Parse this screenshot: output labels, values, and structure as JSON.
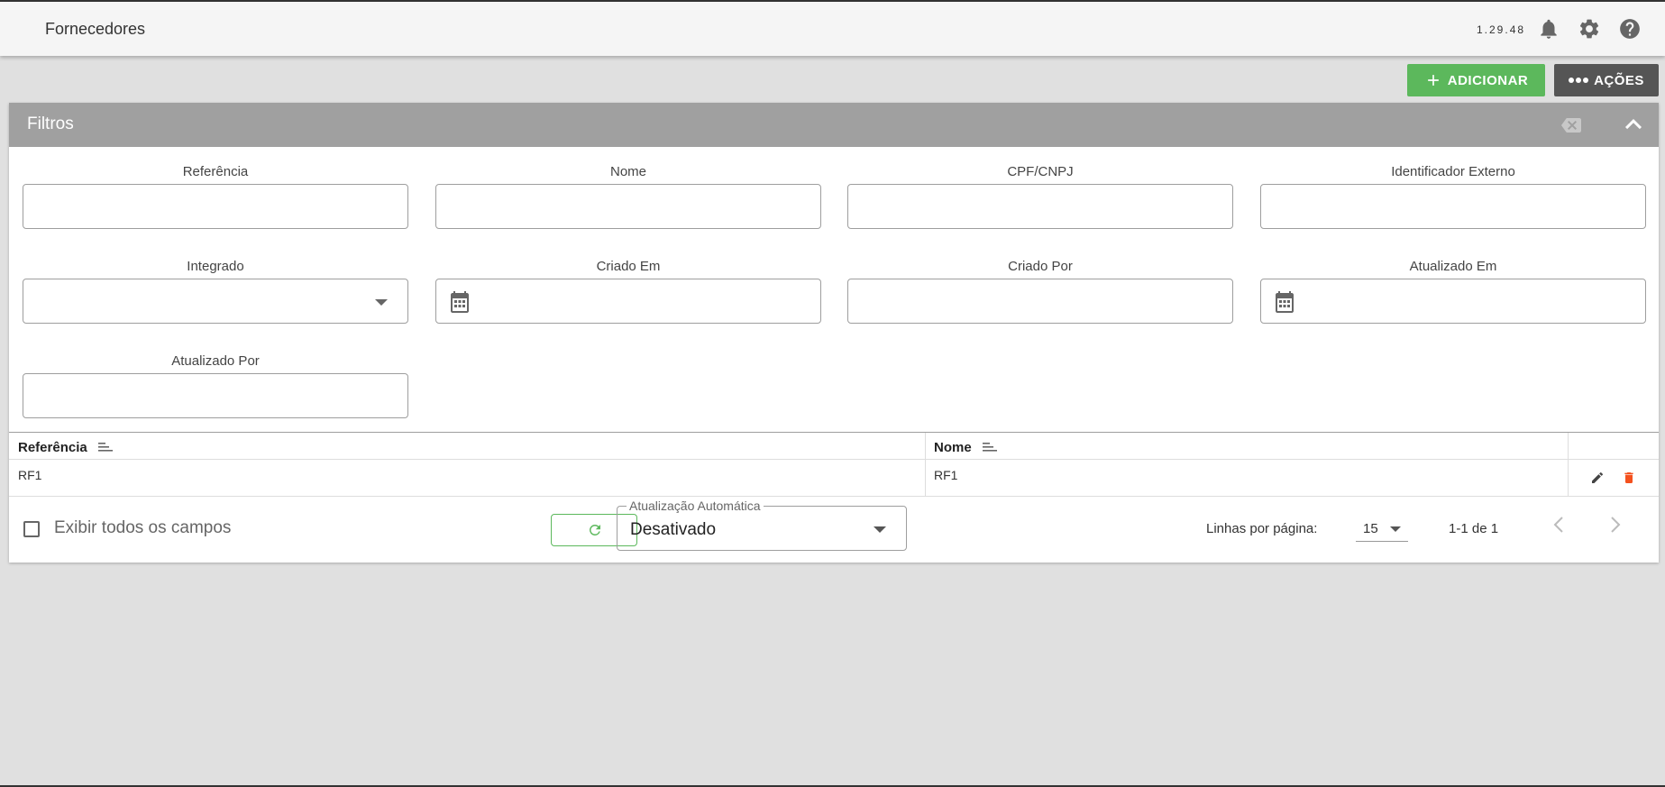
{
  "header": {
    "title": "Fornecedores",
    "version": "1.29.48",
    "icons": [
      "bell-icon",
      "gear-icon",
      "help-icon"
    ]
  },
  "toolbar": {
    "add_label": "ADICIONAR",
    "actions_label": "AÇÕES"
  },
  "filters": {
    "title": "Filtros",
    "fields": {
      "referencia": "Referência",
      "nome": "Nome",
      "cpf_cnpj": "CPF/CNPJ",
      "identificador_externo": "Identificador Externo",
      "integrado": "Integrado",
      "criado_em": "Criado Em",
      "criado_por": "Criado Por",
      "atualizado_em": "Atualizado Em",
      "atualizado_por": "Atualizado Por"
    }
  },
  "grid": {
    "columns": [
      "Referência",
      "Nome"
    ],
    "rows": [
      {
        "referencia": "RF1",
        "nome": "RF1"
      }
    ]
  },
  "footer": {
    "show_all_fields": "Exibir todos os campos",
    "auto_update_label": "Atualização Automática",
    "auto_update_value": "Desativado",
    "rows_per_page_label": "Linhas por página:",
    "rows_per_page_value": "15",
    "range": "1-1 de 1"
  },
  "colors": {
    "accent_green": "#5cb85c",
    "actions_dark": "#555555",
    "filter_header": "#a0a0a0",
    "delete_orange": "#f4511e"
  }
}
